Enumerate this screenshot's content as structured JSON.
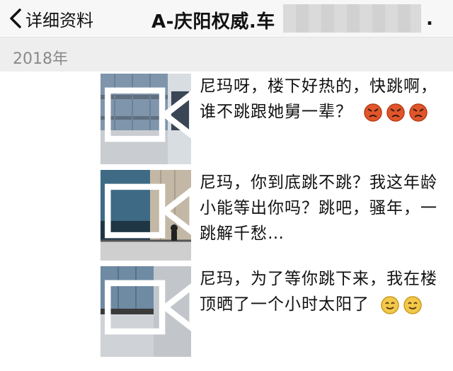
{
  "header": {
    "back_label": "详细资料",
    "title": "A-庆阳权威.车",
    "trailing": "."
  },
  "year_label": "2018年",
  "posts": [
    {
      "text": "尼玛呀，楼下好热的，快跳啊，谁不跳跟她舅一辈？",
      "emoji": [
        "angry-face-icon",
        "angry-face-icon",
        "angry-face-icon"
      ]
    },
    {
      "text": "尼玛，你到底跳不跳？我这年龄小能等出你吗？跳吧，骚年，一跳解千愁…",
      "emoji": []
    },
    {
      "text": "尼玛，为了等你跳下来，我在楼顶晒了一个小时太阳了",
      "emoji": [
        "smiling-face-icon",
        "smiling-face-icon"
      ]
    }
  ],
  "colors": {
    "accent": "#111111",
    "year_text": "#8a8a8a",
    "emoji_angry": "#e0562a",
    "emoji_smile": "#f2c84b"
  }
}
